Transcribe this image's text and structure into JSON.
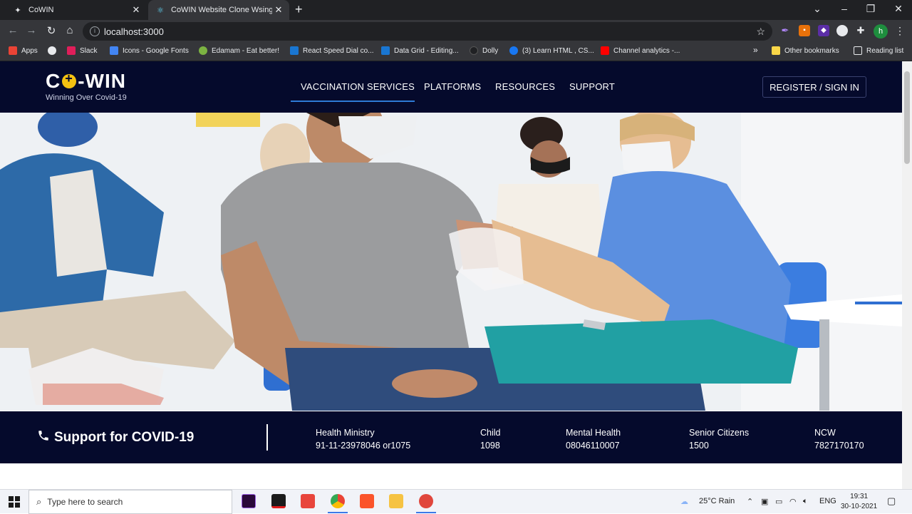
{
  "browser": {
    "tabs": [
      {
        "title": "CoWIN",
        "close": "✕"
      },
      {
        "title": "CoWIN Website Clone Wsing Re",
        "close": "✕"
      }
    ],
    "new_tab": "+",
    "url": "localhost:3000",
    "profile_initial": "h",
    "bookmarks": [
      "Apps",
      "Slack",
      "Icons - Google Fonts",
      "Edamam - Eat better!",
      "React Speed Dial co...",
      "Data Grid - Editing...",
      "Dolly",
      "(3) Learn HTML , CS...",
      "Channel analytics -..."
    ],
    "bookmarks_more": "»",
    "other_bookmarks": "Other bookmarks",
    "reading_list": "Reading list"
  },
  "site": {
    "logo_prefix": "C",
    "logo_suffix": "-WIN",
    "tagline": "Winning Over Covid-19",
    "nav": [
      "VACCINATION SERVICES",
      "PLATFORMS",
      "RESOURCES",
      "SUPPORT"
    ],
    "register_label": "REGISTER / SIGN IN"
  },
  "support": {
    "title": "Support for COVID-19",
    "columns": [
      {
        "label": "Health Ministry",
        "value": "91-11-23978046 or1075"
      },
      {
        "label": "Child",
        "value": "1098"
      },
      {
        "label": "Mental Health",
        "value": "08046110007"
      },
      {
        "label": "Senior Citizens",
        "value": "1500"
      },
      {
        "label": "NCW",
        "value": "7827170170"
      }
    ]
  },
  "taskbar": {
    "search_placeholder": "Type here to search",
    "weather": "25°C  Rain",
    "language": "ENG",
    "time": "19:31",
    "date": "30-10-2021"
  },
  "colors": {
    "header_bg": "#050a2c",
    "accent": "#2e7bd6",
    "logo_dot": "#f5c211"
  }
}
